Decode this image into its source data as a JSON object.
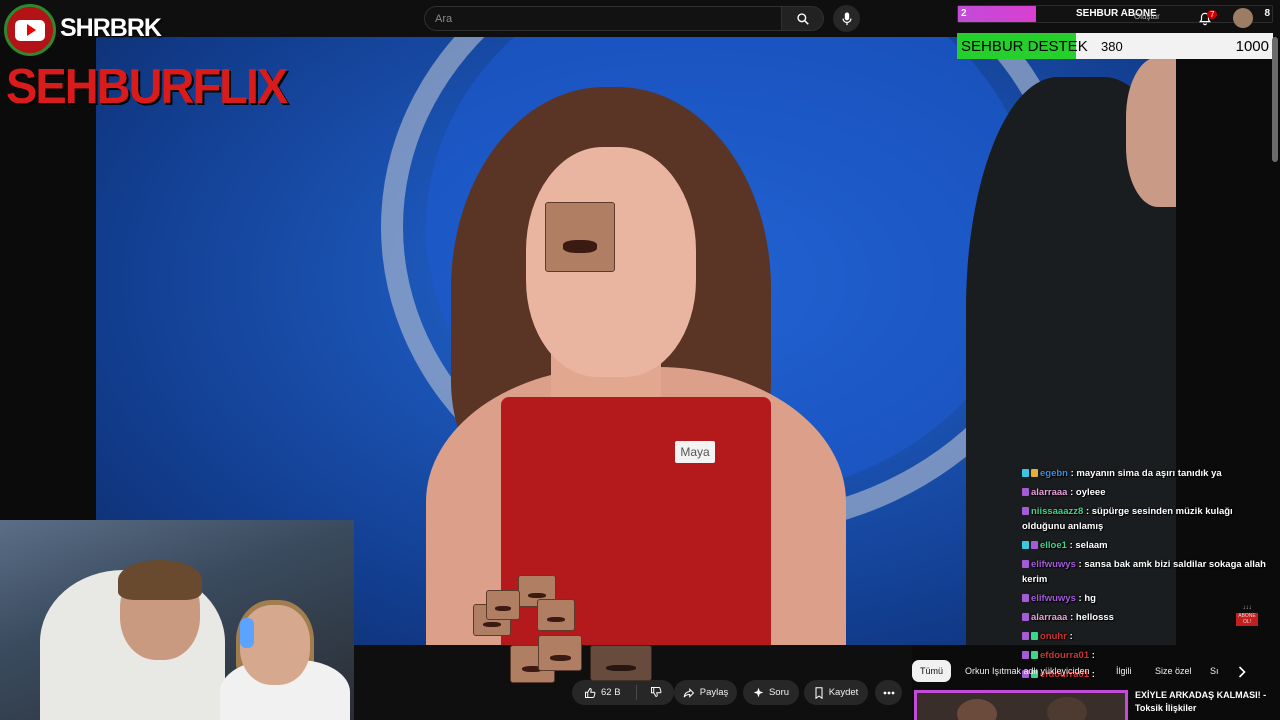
{
  "search": {
    "placeholder": "Ara"
  },
  "overlay": {
    "channel_tag": "SHRBRK",
    "brand": "SEHBURFLIX",
    "stream_bar": {
      "left_value": "2",
      "title": "SEHBUR ABONE",
      "right_value": "8"
    },
    "destek": {
      "label": "SEHBUR DESTEK",
      "value": "380",
      "goal": "1000"
    }
  },
  "header": {
    "create_label": "Oluştur",
    "notification_count": "7"
  },
  "video": {
    "name_tag": "Maya"
  },
  "actions": {
    "like_count": "62 B",
    "share_label": "Paylaş",
    "ask_label": "Soru",
    "save_label": "Kaydet"
  },
  "chat": {
    "messages": [
      {
        "user": "egebn",
        "text": ": mayanın sima da aşırı tanıdık ya",
        "color": "#3b8ee0"
      },
      {
        "user": "alarraaa",
        "text": ": oyleee",
        "color": "#e8a0d8"
      },
      {
        "user": "niissaaazz8",
        "text": ": süpürge sesinden müzik kulağı olduğunu anlamış",
        "color": "#3bd68a"
      },
      {
        "user": "elloe1",
        "text": ": selaam",
        "color": "#3bd68a"
      },
      {
        "user": "elifwuwys",
        "text": ": sansa bak amk bizi saldilar sokaga allah kerim",
        "color": "#a35bd6"
      },
      {
        "user": "elifwuwys",
        "text": ": hg",
        "color": "#a35bd6"
      },
      {
        "user": "alarraaa",
        "text": ": hellosss",
        "color": "#e8a0d8"
      },
      {
        "user": "onuhr",
        "text": ":",
        "color": "#c33"
      },
      {
        "user": "efdourra01",
        "text": ":",
        "color": "#c33"
      },
      {
        "user": "efdourra01",
        "text": ":",
        "color": "#c33"
      }
    ],
    "sub_tag_top": "↓↓↓",
    "sub_tag_box": "ABONE OL!"
  },
  "chips": [
    "Tümü",
    "Orkun Işıtmak adlı yükleyiciden",
    "İlgili",
    "Size özel",
    "Sı"
  ],
  "recommendation": {
    "title": "EXİYLE ARKADAŞ KALMASI! - Toksik İlişkiler"
  }
}
